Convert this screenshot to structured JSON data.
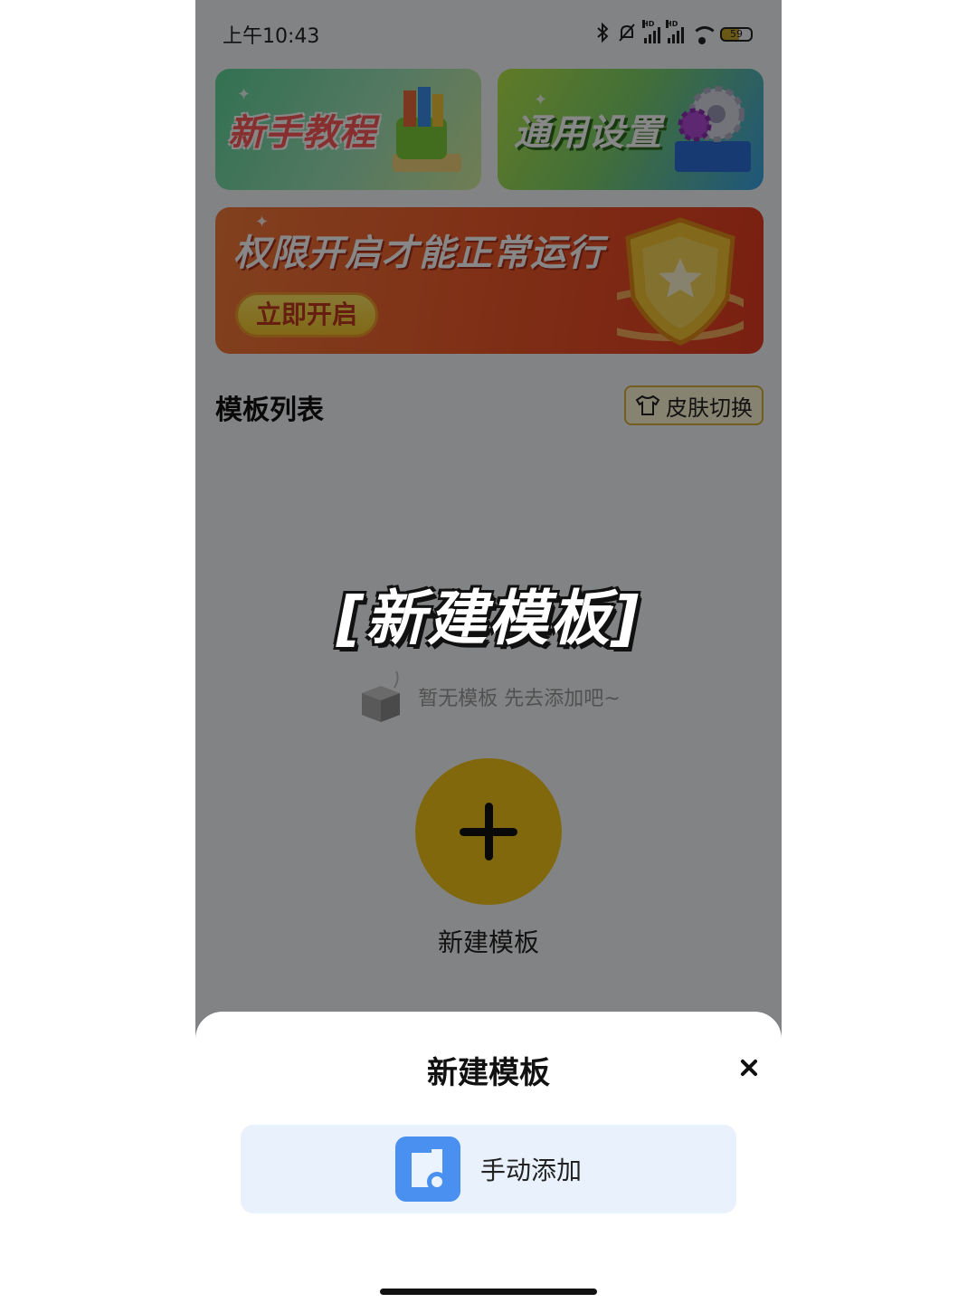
{
  "status_bar": {
    "time": "上午10:43",
    "battery": "59",
    "icons": [
      "bluetooth-icon",
      "mute-icon",
      "signal-hd-icon",
      "signal-hd-icon",
      "wifi-icon",
      "battery-icon"
    ]
  },
  "banners": {
    "tutorial": "新手教程",
    "settings": "通用设置",
    "permission": {
      "title": "权限开启才能正常运行",
      "button": "立即开启"
    }
  },
  "template_list": {
    "title": "模板列表",
    "skin_switch": "皮肤切换",
    "empty_text": "暂无模板 先去添加吧~",
    "add_label": "新建模板"
  },
  "overlay_caption": "[新建模板]",
  "sheet": {
    "title": "新建模板",
    "option_label": "手动添加"
  },
  "colors": {
    "accent_yellow": "#f3c519",
    "sheet_option_bg": "#e9f1fd",
    "banner_orange": "#f05a2a"
  }
}
